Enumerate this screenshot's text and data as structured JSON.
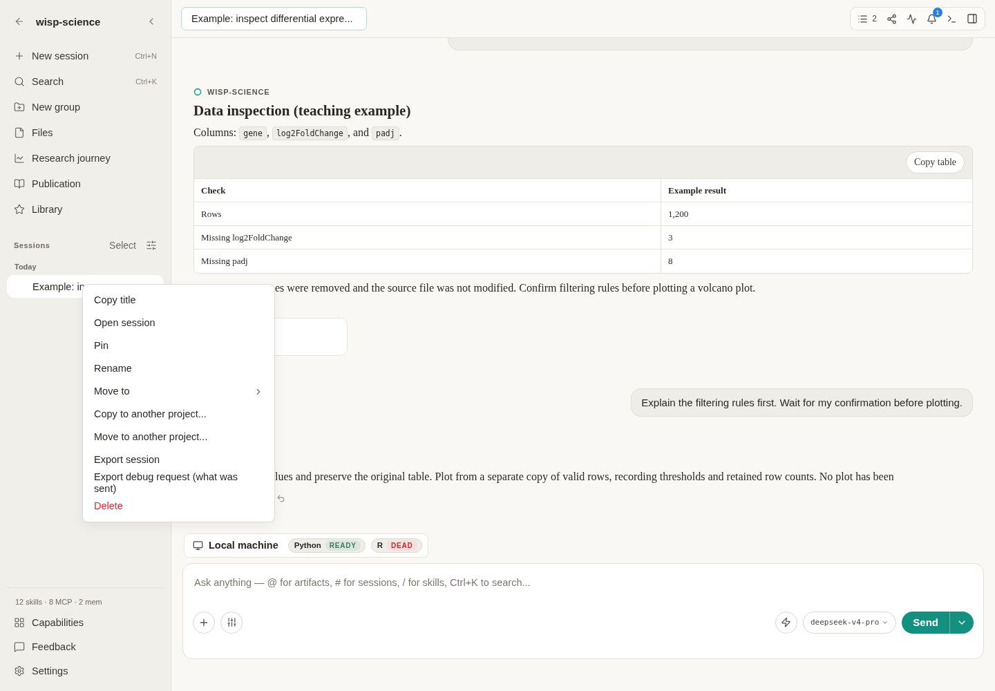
{
  "sidebar": {
    "title": "wisp-science",
    "nav": [
      {
        "label": "New session",
        "shortcut": "Ctrl+N"
      },
      {
        "label": "Search",
        "shortcut": "Ctrl+K"
      },
      {
        "label": "New group"
      },
      {
        "label": "Files"
      },
      {
        "label": "Research journey"
      },
      {
        "label": "Publication"
      },
      {
        "label": "Library"
      }
    ],
    "sessions_heading": "Sessions",
    "select": "Select",
    "group": "Today",
    "sessions": [
      {
        "title": "Example: in",
        "selected": true
      }
    ],
    "stats": "12 skills · 8 MCP · 2 mem",
    "footer": [
      "Capabilities",
      "Feedback",
      "Settings"
    ]
  },
  "context_menu": {
    "items": [
      {
        "label": "Copy title",
        "kind": "normal"
      },
      {
        "label": "Open session",
        "kind": "normal"
      },
      {
        "label": "Pin",
        "kind": "normal"
      },
      {
        "label": "Rename",
        "kind": "normal"
      },
      {
        "label": "Move to",
        "kind": "submenu"
      },
      {
        "label": "Copy to another project...",
        "kind": "normal"
      },
      {
        "label": "Move to another project...",
        "kind": "normal"
      },
      {
        "label": "Export session",
        "kind": "normal"
      },
      {
        "label": "Export debug request (what was sent)",
        "kind": "normal"
      },
      {
        "label": "Delete",
        "kind": "danger"
      }
    ]
  },
  "header": {
    "session_tab": "Example: inspect differential expre...",
    "list_count": "2",
    "notifications": "1"
  },
  "chat": {
    "agent": "WISP-SCIENCE",
    "title": "Data inspection (teaching example)",
    "columns_parts": [
      {
        "kind": "text",
        "text": "Columns: "
      },
      {
        "kind": "code",
        "text": "gene"
      },
      {
        "kind": "text",
        "text": ", "
      },
      {
        "kind": "code",
        "text": "log2FoldChange"
      },
      {
        "kind": "text",
        "text": ", and "
      },
      {
        "kind": "code",
        "text": "padj"
      },
      {
        "kind": "text",
        "text": "."
      }
    ],
    "copy_table": "Copy table",
    "table": {
      "columns": [
        "Check",
        "Example result"
      ],
      "rows": [
        [
          "Rows",
          "1,200"
        ],
        [
          "Missing log2FoldChange",
          "3"
        ],
        [
          "Missing padj",
          "8"
        ]
      ]
    },
    "note": "es were removed and the source file was not modified. Confirm filtering rules before plotting a volcano plot.",
    "user_message": "Explain the filtering rules first. Wait for my confirmation before plotting.",
    "reply": "lues and preserve the original table. Plot from a separate copy of valid rows, recording thresholds and retained row counts. No plot has been"
  },
  "runtime": {
    "host": "Local machine",
    "kernels": [
      {
        "name": "Python",
        "status": "READY",
        "kind": "ready"
      },
      {
        "name": "R",
        "status": "DEAD",
        "kind": "dead"
      }
    ]
  },
  "composer": {
    "placeholder": "Ask anything — @ for artifacts, # for sessions, / for skills, Ctrl+K to search...",
    "model": "deepseek-v4-pro",
    "send": "Send"
  }
}
